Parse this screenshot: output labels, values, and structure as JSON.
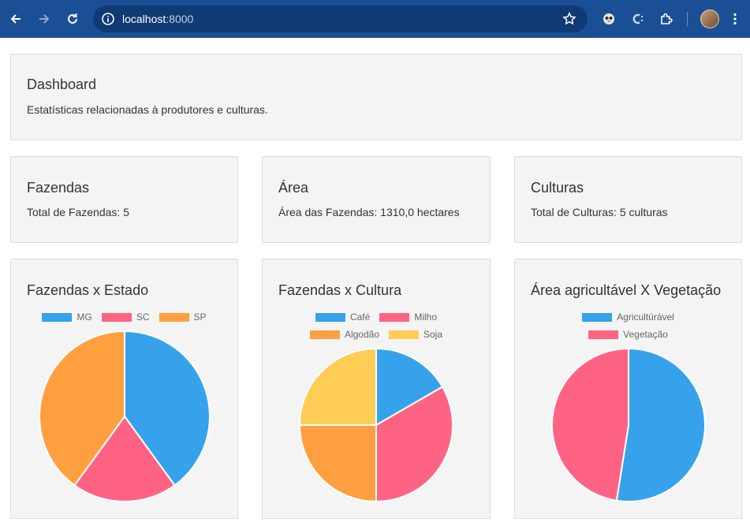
{
  "browser": {
    "url_host": "localhost",
    "url_port": ":8000"
  },
  "header": {
    "title": "Dashboard",
    "subtitle": "Estatísticas relacionadas à produtores e culturas."
  },
  "stats": [
    {
      "title": "Fazendas",
      "text": "Total de Fazendas: 5"
    },
    {
      "title": "Área",
      "text": "Área das Fazendas: 1310,0 hectares"
    },
    {
      "title": "Culturas",
      "text": "Total de Culturas: 5 culturas"
    }
  ],
  "chart_data": [
    {
      "type": "pie",
      "title": "Fazendas x Estado",
      "categories": [
        "MG",
        "SC",
        "SP"
      ],
      "values": [
        2,
        1,
        2
      ],
      "colors": [
        "#36a2eb",
        "#ff6384",
        "#ff9f40"
      ],
      "legend_position": "top"
    },
    {
      "type": "pie",
      "title": "Fazendas x Cultura",
      "categories": [
        "Café",
        "Milho",
        "Algodão",
        "Soja"
      ],
      "values": [
        1,
        2,
        1.5,
        1.5
      ],
      "colors": [
        "#36a2eb",
        "#ff6384",
        "#ff9f40",
        "#ffcd56"
      ],
      "legend_position": "top"
    },
    {
      "type": "pie",
      "title": "Área agricultável X Vegetação",
      "categories": [
        "Agricultúrável",
        "Vegetação"
      ],
      "values": [
        52.5,
        47.5
      ],
      "colors": [
        "#36a2eb",
        "#ff6384"
      ],
      "legend_position": "top"
    }
  ]
}
